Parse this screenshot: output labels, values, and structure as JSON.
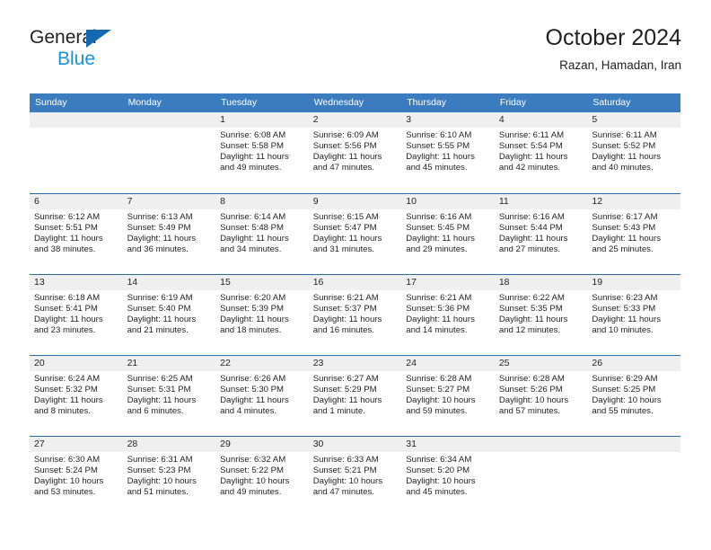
{
  "brand": {
    "name_part1": "General",
    "name_part2": "Blue",
    "logo_icon": "general-blue-triangle-logo"
  },
  "header": {
    "title": "October 2024",
    "subtitle": "Razan, Hamadan, Iran"
  },
  "calendar": {
    "weekday_headers": [
      "Sunday",
      "Monday",
      "Tuesday",
      "Wednesday",
      "Thursday",
      "Friday",
      "Saturday"
    ],
    "colors": {
      "header_background": "#3a7cbe",
      "header_text": "#ffffff",
      "row_separator": "#2b6cad",
      "daynum_band": "#efefef",
      "brand_blue": "#1a8fe0",
      "logo_blue": "#1268b3",
      "text": "#231f20"
    },
    "weeks": [
      [
        {
          "day": "",
          "sunrise": "",
          "sunset": "",
          "daylight_line1": "",
          "daylight_line2": "",
          "empty": true
        },
        {
          "day": "",
          "sunrise": "",
          "sunset": "",
          "daylight_line1": "",
          "daylight_line2": "",
          "empty": true
        },
        {
          "day": "1",
          "sunrise": "Sunrise: 6:08 AM",
          "sunset": "Sunset: 5:58 PM",
          "daylight_line1": "Daylight: 11 hours",
          "daylight_line2": "and 49 minutes.",
          "empty": false
        },
        {
          "day": "2",
          "sunrise": "Sunrise: 6:09 AM",
          "sunset": "Sunset: 5:56 PM",
          "daylight_line1": "Daylight: 11 hours",
          "daylight_line2": "and 47 minutes.",
          "empty": false
        },
        {
          "day": "3",
          "sunrise": "Sunrise: 6:10 AM",
          "sunset": "Sunset: 5:55 PM",
          "daylight_line1": "Daylight: 11 hours",
          "daylight_line2": "and 45 minutes.",
          "empty": false
        },
        {
          "day": "4",
          "sunrise": "Sunrise: 6:11 AM",
          "sunset": "Sunset: 5:54 PM",
          "daylight_line1": "Daylight: 11 hours",
          "daylight_line2": "and 42 minutes.",
          "empty": false
        },
        {
          "day": "5",
          "sunrise": "Sunrise: 6:11 AM",
          "sunset": "Sunset: 5:52 PM",
          "daylight_line1": "Daylight: 11 hours",
          "daylight_line2": "and 40 minutes.",
          "empty": false
        }
      ],
      [
        {
          "day": "6",
          "sunrise": "Sunrise: 6:12 AM",
          "sunset": "Sunset: 5:51 PM",
          "daylight_line1": "Daylight: 11 hours",
          "daylight_line2": "and 38 minutes.",
          "empty": false
        },
        {
          "day": "7",
          "sunrise": "Sunrise: 6:13 AM",
          "sunset": "Sunset: 5:49 PM",
          "daylight_line1": "Daylight: 11 hours",
          "daylight_line2": "and 36 minutes.",
          "empty": false
        },
        {
          "day": "8",
          "sunrise": "Sunrise: 6:14 AM",
          "sunset": "Sunset: 5:48 PM",
          "daylight_line1": "Daylight: 11 hours",
          "daylight_line2": "and 34 minutes.",
          "empty": false
        },
        {
          "day": "9",
          "sunrise": "Sunrise: 6:15 AM",
          "sunset": "Sunset: 5:47 PM",
          "daylight_line1": "Daylight: 11 hours",
          "daylight_line2": "and 31 minutes.",
          "empty": false
        },
        {
          "day": "10",
          "sunrise": "Sunrise: 6:16 AM",
          "sunset": "Sunset: 5:45 PM",
          "daylight_line1": "Daylight: 11 hours",
          "daylight_line2": "and 29 minutes.",
          "empty": false
        },
        {
          "day": "11",
          "sunrise": "Sunrise: 6:16 AM",
          "sunset": "Sunset: 5:44 PM",
          "daylight_line1": "Daylight: 11 hours",
          "daylight_line2": "and 27 minutes.",
          "empty": false
        },
        {
          "day": "12",
          "sunrise": "Sunrise: 6:17 AM",
          "sunset": "Sunset: 5:43 PM",
          "daylight_line1": "Daylight: 11 hours",
          "daylight_line2": "and 25 minutes.",
          "empty": false
        }
      ],
      [
        {
          "day": "13",
          "sunrise": "Sunrise: 6:18 AM",
          "sunset": "Sunset: 5:41 PM",
          "daylight_line1": "Daylight: 11 hours",
          "daylight_line2": "and 23 minutes.",
          "empty": false
        },
        {
          "day": "14",
          "sunrise": "Sunrise: 6:19 AM",
          "sunset": "Sunset: 5:40 PM",
          "daylight_line1": "Daylight: 11 hours",
          "daylight_line2": "and 21 minutes.",
          "empty": false
        },
        {
          "day": "15",
          "sunrise": "Sunrise: 6:20 AM",
          "sunset": "Sunset: 5:39 PM",
          "daylight_line1": "Daylight: 11 hours",
          "daylight_line2": "and 18 minutes.",
          "empty": false
        },
        {
          "day": "16",
          "sunrise": "Sunrise: 6:21 AM",
          "sunset": "Sunset: 5:37 PM",
          "daylight_line1": "Daylight: 11 hours",
          "daylight_line2": "and 16 minutes.",
          "empty": false
        },
        {
          "day": "17",
          "sunrise": "Sunrise: 6:21 AM",
          "sunset": "Sunset: 5:36 PM",
          "daylight_line1": "Daylight: 11 hours",
          "daylight_line2": "and 14 minutes.",
          "empty": false
        },
        {
          "day": "18",
          "sunrise": "Sunrise: 6:22 AM",
          "sunset": "Sunset: 5:35 PM",
          "daylight_line1": "Daylight: 11 hours",
          "daylight_line2": "and 12 minutes.",
          "empty": false
        },
        {
          "day": "19",
          "sunrise": "Sunrise: 6:23 AM",
          "sunset": "Sunset: 5:33 PM",
          "daylight_line1": "Daylight: 11 hours",
          "daylight_line2": "and 10 minutes.",
          "empty": false
        }
      ],
      [
        {
          "day": "20",
          "sunrise": "Sunrise: 6:24 AM",
          "sunset": "Sunset: 5:32 PM",
          "daylight_line1": "Daylight: 11 hours",
          "daylight_line2": "and 8 minutes.",
          "empty": false
        },
        {
          "day": "21",
          "sunrise": "Sunrise: 6:25 AM",
          "sunset": "Sunset: 5:31 PM",
          "daylight_line1": "Daylight: 11 hours",
          "daylight_line2": "and 6 minutes.",
          "empty": false
        },
        {
          "day": "22",
          "sunrise": "Sunrise: 6:26 AM",
          "sunset": "Sunset: 5:30 PM",
          "daylight_line1": "Daylight: 11 hours",
          "daylight_line2": "and 4 minutes.",
          "empty": false
        },
        {
          "day": "23",
          "sunrise": "Sunrise: 6:27 AM",
          "sunset": "Sunset: 5:29 PM",
          "daylight_line1": "Daylight: 11 hours",
          "daylight_line2": "and 1 minute.",
          "empty": false
        },
        {
          "day": "24",
          "sunrise": "Sunrise: 6:28 AM",
          "sunset": "Sunset: 5:27 PM",
          "daylight_line1": "Daylight: 10 hours",
          "daylight_line2": "and 59 minutes.",
          "empty": false
        },
        {
          "day": "25",
          "sunrise": "Sunrise: 6:28 AM",
          "sunset": "Sunset: 5:26 PM",
          "daylight_line1": "Daylight: 10 hours",
          "daylight_line2": "and 57 minutes.",
          "empty": false
        },
        {
          "day": "26",
          "sunrise": "Sunrise: 6:29 AM",
          "sunset": "Sunset: 5:25 PM",
          "daylight_line1": "Daylight: 10 hours",
          "daylight_line2": "and 55 minutes.",
          "empty": false
        }
      ],
      [
        {
          "day": "27",
          "sunrise": "Sunrise: 6:30 AM",
          "sunset": "Sunset: 5:24 PM",
          "daylight_line1": "Daylight: 10 hours",
          "daylight_line2": "and 53 minutes.",
          "empty": false
        },
        {
          "day": "28",
          "sunrise": "Sunrise: 6:31 AM",
          "sunset": "Sunset: 5:23 PM",
          "daylight_line1": "Daylight: 10 hours",
          "daylight_line2": "and 51 minutes.",
          "empty": false
        },
        {
          "day": "29",
          "sunrise": "Sunrise: 6:32 AM",
          "sunset": "Sunset: 5:22 PM",
          "daylight_line1": "Daylight: 10 hours",
          "daylight_line2": "and 49 minutes.",
          "empty": false
        },
        {
          "day": "30",
          "sunrise": "Sunrise: 6:33 AM",
          "sunset": "Sunset: 5:21 PM",
          "daylight_line1": "Daylight: 10 hours",
          "daylight_line2": "and 47 minutes.",
          "empty": false
        },
        {
          "day": "31",
          "sunrise": "Sunrise: 6:34 AM",
          "sunset": "Sunset: 5:20 PM",
          "daylight_line1": "Daylight: 10 hours",
          "daylight_line2": "and 45 minutes.",
          "empty": false
        },
        {
          "day": "",
          "sunrise": "",
          "sunset": "",
          "daylight_line1": "",
          "daylight_line2": "",
          "empty": true
        },
        {
          "day": "",
          "sunrise": "",
          "sunset": "",
          "daylight_line1": "",
          "daylight_line2": "",
          "empty": true
        }
      ]
    ]
  }
}
